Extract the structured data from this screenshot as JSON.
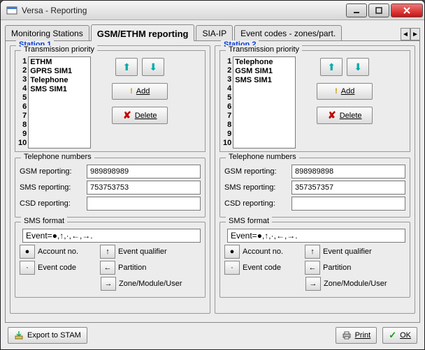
{
  "window": {
    "title": "Versa - Reporting"
  },
  "tabs": {
    "t0": "Monitoring Stations",
    "t1": "GSM/ETHM reporting",
    "t2": "SIA-IP",
    "t3": "Event codes - zones/part."
  },
  "station1": {
    "legend": "Station 1",
    "tp_legend": "Transmission priority",
    "items": {
      "i0": "ETHM",
      "i1": "GPRS SIM1",
      "i2": "Telephone",
      "i3": "SMS SIM1",
      "i4": "",
      "i5": "",
      "i6": "",
      "i7": "",
      "i8": "",
      "i9": ""
    },
    "nums": {
      "n0": "1",
      "n1": "2",
      "n2": "3",
      "n3": "4",
      "n4": "5",
      "n5": "6",
      "n6": "7",
      "n7": "8",
      "n8": "9",
      "n9": "10"
    },
    "add": "Add",
    "delete": "Delete",
    "phones_legend": "Telephone numbers",
    "gsm_label": "GSM reporting:",
    "gsm_value": "989898989",
    "sms_label": "SMS reporting:",
    "sms_value": "753753753",
    "csd_label": "CSD reporting:",
    "csd_value": "",
    "smsf_legend": "SMS format",
    "smsf_value": "Event=●,↑,·,←,→.",
    "btn_account": "Account no.",
    "btn_eventcode": "Event code",
    "btn_qualifier": "Event qualifier",
    "btn_partition": "Partition",
    "btn_zmu": "Zone/Module/User"
  },
  "station2": {
    "legend": "Station 2",
    "tp_legend": "Transmission priority",
    "items": {
      "i0": "Telephone",
      "i1": "GSM SIM1",
      "i2": "SMS SIM1",
      "i3": "",
      "i4": "",
      "i5": "",
      "i6": "",
      "i7": "",
      "i8": "",
      "i9": ""
    },
    "nums": {
      "n0": "1",
      "n1": "2",
      "n2": "3",
      "n3": "4",
      "n4": "5",
      "n5": "6",
      "n6": "7",
      "n7": "8",
      "n8": "9",
      "n9": "10"
    },
    "add": "Add",
    "delete": "Delete",
    "phones_legend": "Telephone numbers",
    "gsm_label": "GSM reporting:",
    "gsm_value": "898989898",
    "sms_label": "SMS reporting:",
    "sms_value": "357357357",
    "csd_label": "CSD reporting:",
    "csd_value": "",
    "smsf_legend": "SMS format",
    "smsf_value": "Event=●,↑,·,←,→.",
    "btn_account": "Account no.",
    "btn_eventcode": "Event code",
    "btn_qualifier": "Event qualifier",
    "btn_partition": "Partition",
    "btn_zmu": "Zone/Module/User"
  },
  "bottom": {
    "export": "Export to STAM",
    "print": "Print",
    "ok": "OK"
  }
}
